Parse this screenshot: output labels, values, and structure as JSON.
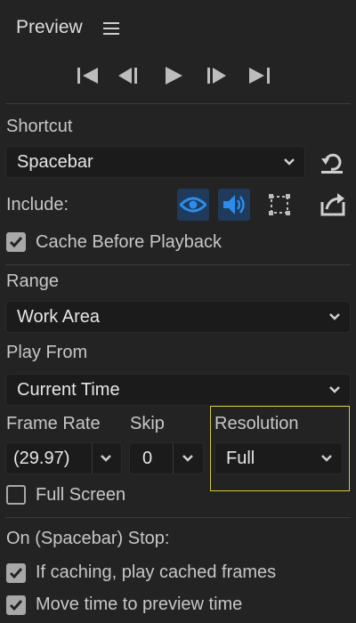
{
  "header": {
    "title": "Preview"
  },
  "transport": {
    "icons": [
      "first-frame-icon",
      "previous-frame-icon",
      "play-icon",
      "next-frame-icon",
      "last-frame-icon"
    ]
  },
  "shortcut": {
    "label": "Shortcut",
    "value": "Spacebar"
  },
  "include": {
    "label": "Include:",
    "icons": [
      "video-eye-icon",
      "audio-speaker-icon",
      "overlays-icon"
    ]
  },
  "cache_before_playback": {
    "label": "Cache Before Playback",
    "checked": true
  },
  "range": {
    "label": "Range",
    "value": "Work Area"
  },
  "play_from": {
    "label": "Play From",
    "value": "Current Time"
  },
  "frame_rate": {
    "label": "Frame Rate",
    "value": "(29.97)"
  },
  "skip": {
    "label": "Skip",
    "value": "0"
  },
  "resolution": {
    "label": "Resolution",
    "value": "Full"
  },
  "full_screen": {
    "label": "Full Screen",
    "checked": false
  },
  "on_stop": {
    "label": "On (Spacebar) Stop:",
    "options": [
      {
        "label": "If caching, play cached frames",
        "checked": true
      },
      {
        "label": "Move time to preview time",
        "checked": true
      }
    ]
  },
  "colors": {
    "background": "#232323",
    "active_blue": "#2d8ceb",
    "highlight_yellow": "#d4c93a"
  }
}
